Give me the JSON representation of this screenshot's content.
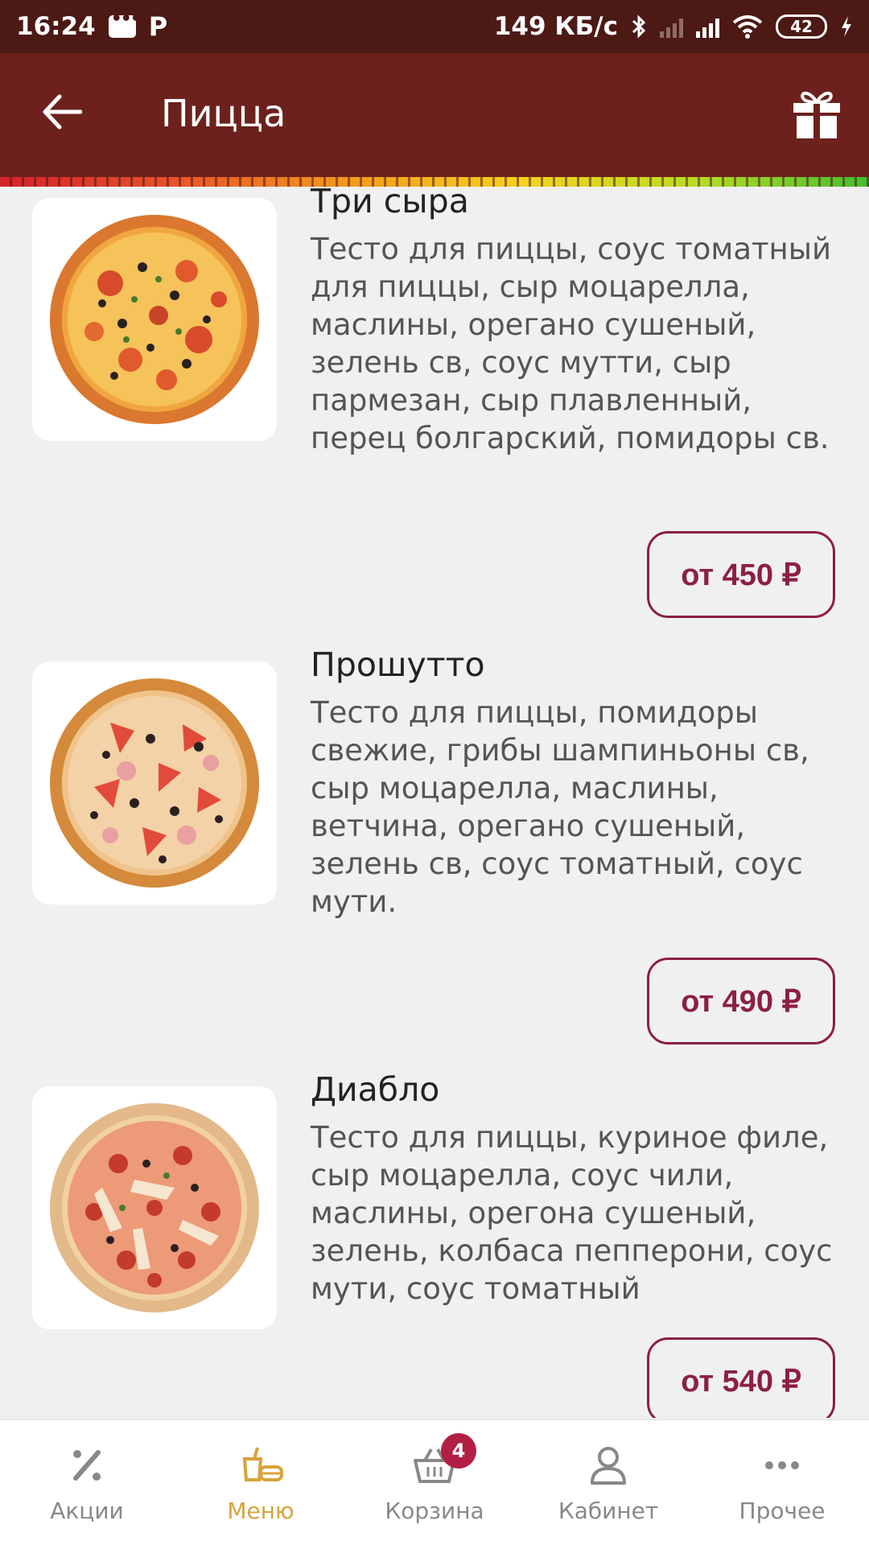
{
  "status_bar": {
    "time": "16:24",
    "net_speed": "149 КБ/с",
    "battery": "42",
    "icons": [
      "message-icon",
      "parking-p-icon",
      "bluetooth-icon",
      "signal-icon",
      "wifi-icon",
      "battery-icon",
      "charging-icon"
    ]
  },
  "app_bar": {
    "title": "Пицца",
    "back_icon": "back-arrow-icon",
    "gift_icon": "gift-icon"
  },
  "products": [
    {
      "name": "Три сыра",
      "description": "Тесто для пиццы, соус томатный для пиццы, сыр моцарелла, маслины, орегано сушеный, зелень св, соус мутти, сыр пармезан, сыр плавленный, перец болгарский, помидоры св.",
      "price": "от 450 ₽"
    },
    {
      "name": "Прошутто",
      "description": "Тесто для пиццы, помидоры свежие, грибы шампиньоны св, сыр моцарелла, маслины, ветчина, орегано сушеный, зелень св, соус томатный, соус мути.",
      "price": "от 490 ₽"
    },
    {
      "name": "Диабло",
      "description": "Тесто для пиццы, куриное филе, сыр моцарелла, соус чили, маслины, орегона сушеный, зелень, колбаса пепперони, соус мути, соус томатный",
      "price": "от 540 ₽"
    }
  ],
  "bottom_nav": {
    "items": [
      {
        "label": "Акции",
        "icon": "percent-icon"
      },
      {
        "label": "Меню",
        "icon": "menu-food-icon"
      },
      {
        "label": "Корзина",
        "icon": "basket-icon"
      },
      {
        "label": "Кабинет",
        "icon": "user-icon"
      },
      {
        "label": "Прочее",
        "icon": "more-icon"
      }
    ],
    "active_index": 1,
    "cart_badge": "4"
  },
  "colors": {
    "status_bar": "#4c1915",
    "app_bar": "#6c211d",
    "price_accent": "#8c1f45",
    "nav_active": "#d6a43a",
    "badge": "#b11f44"
  }
}
